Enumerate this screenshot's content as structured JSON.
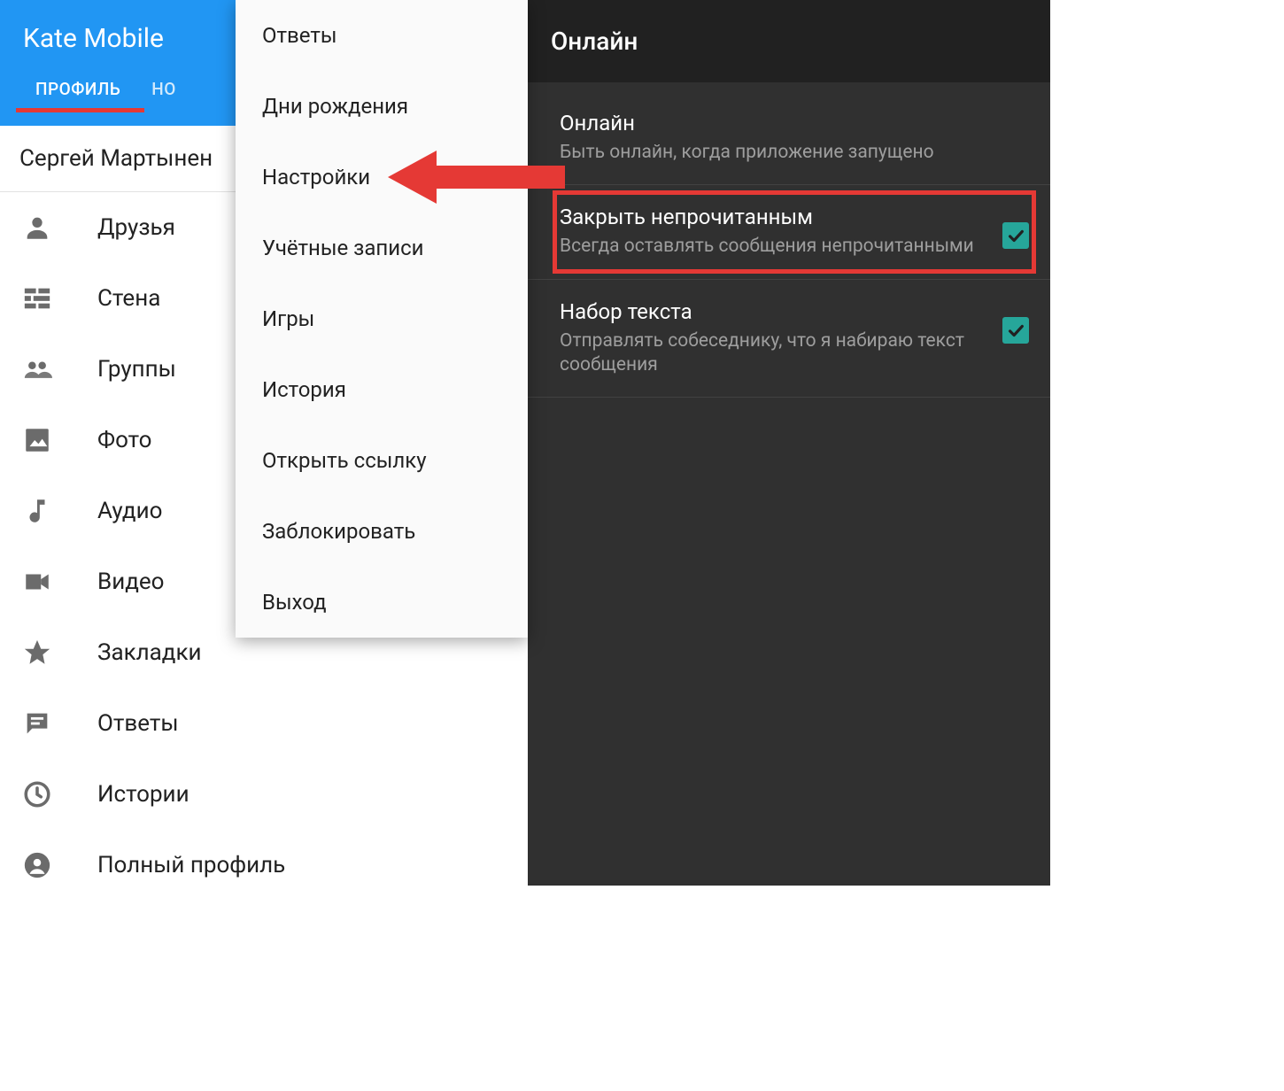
{
  "colors": {
    "primary": "#2196f3",
    "accent_red": "#e53935",
    "accent_teal": "#26a69a",
    "dark_bg": "#303030",
    "dark_header": "#212121"
  },
  "left": {
    "app_title": "Kate Mobile",
    "tabs": [
      {
        "label": "ПРОФИЛЬ",
        "active": true
      },
      {
        "label": "НО",
        "active": false
      }
    ],
    "username": "Сергей Мартынен",
    "nav": [
      {
        "icon": "person-icon",
        "label": "Друзья"
      },
      {
        "icon": "wall-icon",
        "label": "Стена"
      },
      {
        "icon": "groups-icon",
        "label": "Группы"
      },
      {
        "icon": "photo-icon",
        "label": "Фото"
      },
      {
        "icon": "music-icon",
        "label": "Аудио"
      },
      {
        "icon": "video-icon",
        "label": "Видео"
      },
      {
        "icon": "star-icon",
        "label": "Закладки"
      },
      {
        "icon": "chat-icon",
        "label": "Ответы"
      },
      {
        "icon": "stories-icon",
        "label": "Истории"
      },
      {
        "icon": "profile-icon",
        "label": "Полный профиль"
      }
    ]
  },
  "popup": {
    "items": [
      "Ответы",
      "Дни рождения",
      "Настройки",
      "Учётные записи",
      "Игры",
      "История",
      "Открыть ссылку",
      "Заблокировать",
      "Выход"
    ]
  },
  "right": {
    "header": "Онлайн",
    "settings": [
      {
        "title": "Онлайн",
        "sub": "Быть онлайн, когда приложение запущено",
        "checkbox": false,
        "highlighted": false
      },
      {
        "title": "Закрыть непрочитанным",
        "sub": "Всегда оставлять сообщения непрочитанными",
        "checkbox": true,
        "highlighted": true
      },
      {
        "title": "Набор текста",
        "sub": "Отправлять собеседнику, что я набираю текст сообщения",
        "checkbox": true,
        "highlighted": false
      }
    ]
  }
}
